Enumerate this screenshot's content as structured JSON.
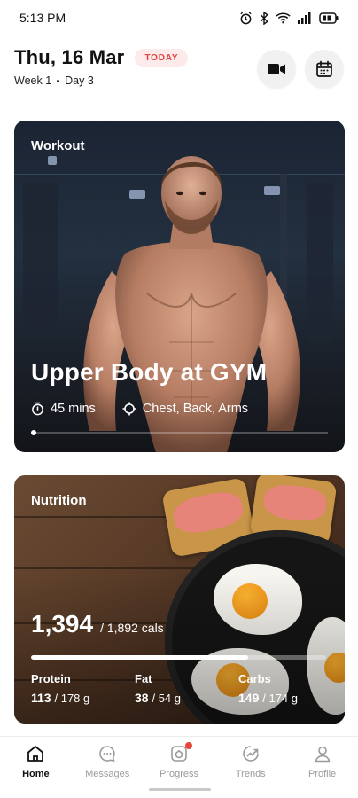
{
  "status_bar": {
    "time": "5:13 PM",
    "icons": [
      "alarm-icon",
      "bluetooth-icon",
      "wifi-icon",
      "signal-icon",
      "battery-icon"
    ]
  },
  "header": {
    "date": "Thu, 16 Mar",
    "badge": "TODAY",
    "week": "Week 1",
    "day": "Day 3",
    "buttons": [
      "video-camera-icon",
      "calendar-icon"
    ]
  },
  "workout": {
    "label": "Workout",
    "title": "Upper Body at GYM",
    "duration": "45 mins",
    "targets": "Chest, Back, Arms"
  },
  "nutrition": {
    "label": "Nutrition",
    "calories": "1,394",
    "calories_total": "/ 1,892 cals",
    "calories_progress": 0.737,
    "macros": [
      {
        "name": "Protein",
        "value": "113",
        "total": "/ 178 g"
      },
      {
        "name": "Fat",
        "value": "38",
        "total": "/ 54 g"
      },
      {
        "name": "Carbs",
        "value": "149",
        "total": "/ 174 g"
      }
    ]
  },
  "nav": {
    "items": [
      {
        "label": "Home",
        "icon": "home-icon",
        "active": true
      },
      {
        "label": "Messages",
        "icon": "message-icon",
        "active": false
      },
      {
        "label": "Progress",
        "icon": "progress-icon",
        "active": false
      },
      {
        "label": "Trends",
        "icon": "trends-icon",
        "active": false
      },
      {
        "label": "Profile",
        "icon": "profile-icon",
        "active": false
      }
    ]
  },
  "colors": {
    "accent": "#e0453d",
    "badge_bg": "#fdeaea"
  }
}
